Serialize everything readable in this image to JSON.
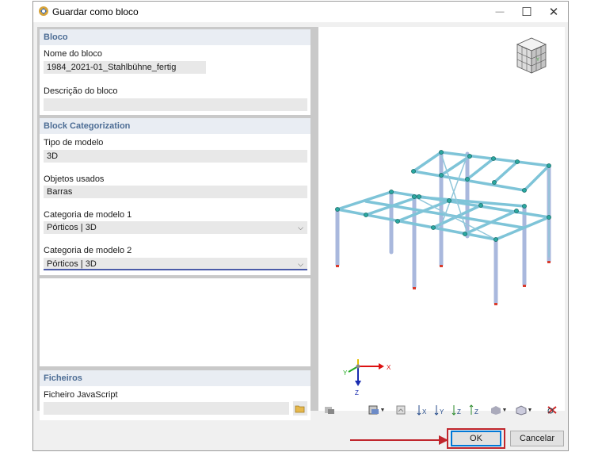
{
  "window": {
    "title": "Guardar como bloco",
    "minimize_glyph": "—",
    "maximize_glyph": "☐",
    "close_glyph": "✕"
  },
  "bloco": {
    "section_title": "Bloco",
    "name_label": "Nome do bloco",
    "name_value": "1984_2021-01_Stahlbühne_fertig",
    "description_label": "Descrição do bloco",
    "description_value": ""
  },
  "categorization": {
    "section_title": "Block Categorization",
    "model_type_label": "Tipo de modelo",
    "model_type_value": "3D",
    "objects_label": "Objetos usados",
    "objects_value": "Barras",
    "category1_label": "Categoria de modelo 1",
    "category1_value": "Pórticos | 3D",
    "category2_label": "Categoria de modelo 2",
    "category2_value": "Pórticos | 3D"
  },
  "files": {
    "section_title": "Ficheiros",
    "js_label": "Ficheiro JavaScript",
    "js_value": ""
  },
  "axes": {
    "x": "X",
    "y": "Y",
    "z": "Z"
  },
  "toolbar": {
    "icons": [
      "render-icon",
      "display-icon",
      "print-icon",
      "view-x-icon",
      "view-y-icon",
      "view-z-icon",
      "view-neg-z-icon",
      "render-mode-icon",
      "view-cube-icon",
      "reset-icon"
    ]
  },
  "buttons": {
    "ok": "OK",
    "cancel": "Cancelar"
  },
  "colors": {
    "accent": "#4d6d95",
    "highlight": "#c0262c",
    "structure": "#7ec4d8"
  }
}
